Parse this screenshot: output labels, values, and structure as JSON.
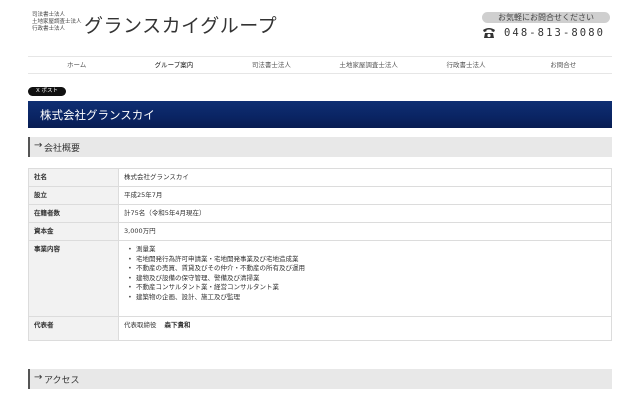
{
  "header": {
    "corp_types": [
      "司法書士法人",
      "土地家屋調査士法人",
      "行政書士法人"
    ],
    "logo_text": "グランスカイグループ",
    "contact_label": "お気軽にお問合せください",
    "phone_icon": "phone-icon",
    "phone_number": "048-813-8080"
  },
  "nav": {
    "items": [
      {
        "label": "ホーム"
      },
      {
        "label": "グループ案内"
      },
      {
        "label": "司法書士法人"
      },
      {
        "label": "土地家屋調査士法人"
      },
      {
        "label": "行政書士法人"
      },
      {
        "label": "お問合せ"
      }
    ]
  },
  "x_post_label": "X ポスト",
  "page_title": "株式会社グランスカイ",
  "company_section": {
    "heading": "会社概要",
    "rows": [
      {
        "label": "社名",
        "value": "株式会社グランスカイ"
      },
      {
        "label": "設立",
        "value": "平成25年7月"
      },
      {
        "label": "在籍者数",
        "value": "計75名（令和5年4月現在）"
      },
      {
        "label": "資本金",
        "value": "3,000万円"
      }
    ],
    "business_label": "事業内容",
    "business_items": [
      "測量業",
      "宅地開発行為許可申請業・宅地開発事業及び宅地造成業",
      "不動産の売買、賃貸及びその仲介・不動産の所有及び運用",
      "建物及び設備の保守管理、警備及び清掃業",
      "不動産コンサルタント業・経営コンサルタント業",
      "建築物の企画、設計、施工及び監理"
    ],
    "rep_label": "代表者",
    "rep_title": "代表取締役",
    "rep_name": "森下貴和"
  },
  "access_section": {
    "heading": "アクセス"
  },
  "colors": {
    "banner": "#0a2463",
    "section_bg": "#e8e8e8",
    "table_header_bg": "#f2f2f2"
  }
}
